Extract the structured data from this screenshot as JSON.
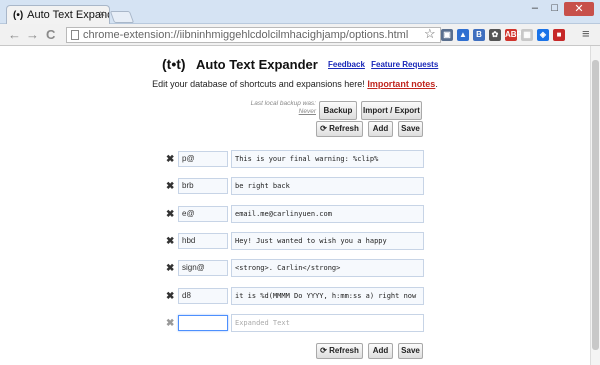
{
  "browser": {
    "tab_title": "Auto Text Expander : Optio",
    "tab_favicon": "(•)",
    "tab_close": "×",
    "url": "chrome-extension://iibninhmiggehlcdolcilmhacighjamp/options.html",
    "nav_back": "←",
    "nav_forward": "→",
    "reload": "C",
    "star": "☆",
    "menu": "≡",
    "win_min": "–",
    "win_max": "□",
    "win_close": "✕",
    "extensions": [
      {
        "name": "ext-camera-icon",
        "color": "#5a6f8e",
        "glyph": "▣"
      },
      {
        "name": "ext-chart-icon",
        "color": "#2f6fd1",
        "glyph": "▲"
      },
      {
        "name": "ext-b-icon",
        "color": "#3f6fbf",
        "glyph": "B"
      },
      {
        "name": "ext-gear-icon",
        "color": "#555555",
        "glyph": "✿"
      },
      {
        "name": "ext-abp-icon",
        "color": "#d0342c",
        "glyph": "ABP"
      },
      {
        "name": "ext-pocket-icon",
        "color": "#c8c8c8",
        "glyph": "▦"
      },
      {
        "name": "ext-cast-icon",
        "color": "#1a73e8",
        "glyph": "◈"
      },
      {
        "name": "ext-red-icon",
        "color": "#c62828",
        "glyph": "■"
      }
    ]
  },
  "header": {
    "logo": "(t•t)",
    "title": "Auto Text Expander",
    "feedback_link": "Feedback",
    "feature_link": "Feature Requests",
    "tagline": "Edit your database of shortcuts and expansions here!",
    "important_link": "Important notes",
    "tagline_end": "."
  },
  "backup": {
    "note_line1": "Last local backup was:",
    "note_line2": "Never",
    "backup_label": "Backup",
    "import_export_label": "Import / Export"
  },
  "actions": {
    "refresh_label": "⟳ Refresh",
    "add_label": "Add",
    "save_label": "Save"
  },
  "shortcuts": [
    {
      "shortcut": "p@",
      "expansion": "This is your final warning: %clip%"
    },
    {
      "shortcut": "brb",
      "expansion": "be right back"
    },
    {
      "shortcut": "e@",
      "expansion": "email.me@carlinyuen.com"
    },
    {
      "shortcut": "hbd",
      "expansion": "Hey! Just wanted to wish you a happy"
    },
    {
      "shortcut": "sign@",
      "expansion": "<strong>. Carlin</strong>"
    },
    {
      "shortcut": "d8",
      "expansion": "it is %d(MMMM Do YYYY, h:mm:ss a) right now"
    }
  ],
  "empty_row": {
    "shortcut_value": "",
    "expansion_placeholder": "Expanded Text"
  },
  "remove_glyph": "✖"
}
